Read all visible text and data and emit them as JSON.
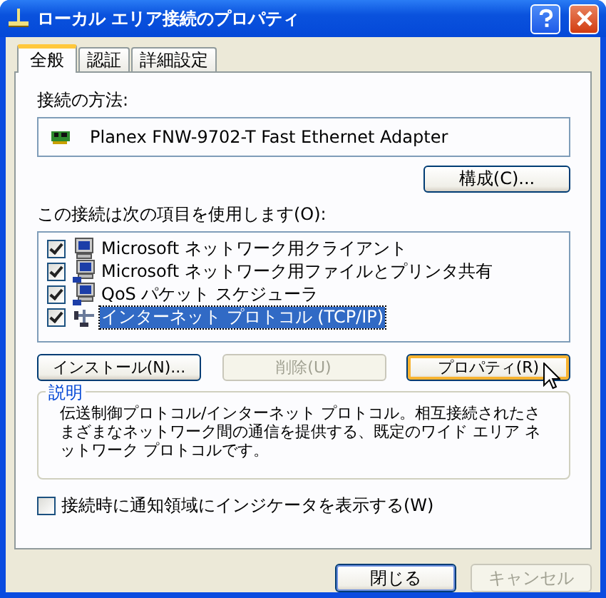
{
  "window": {
    "title": "ローカル エリア接続のプロパティ"
  },
  "tabs": [
    {
      "label": "全般",
      "selected": true
    },
    {
      "label": "認証",
      "selected": false
    },
    {
      "label": "詳細設定",
      "selected": false
    }
  ],
  "connect_using": {
    "label": "接続の方法:",
    "adapter": "Planex FNW-9702-T Fast Ethernet Adapter",
    "configure_button": "構成(C)..."
  },
  "components": {
    "label": "この接続は次の項目を使用します(O):",
    "items": [
      {
        "name": "Microsoft ネットワーク用クライアント",
        "checked": true,
        "selected": false,
        "kind": "client"
      },
      {
        "name": "Microsoft ネットワーク用ファイルとプリンタ共有",
        "checked": true,
        "selected": false,
        "kind": "service"
      },
      {
        "name": "QoS パケット スケジューラ",
        "checked": true,
        "selected": false,
        "kind": "service"
      },
      {
        "name": "インターネット プロトコル (TCP/IP)",
        "checked": true,
        "selected": true,
        "kind": "protocol"
      }
    ]
  },
  "item_buttons": [
    {
      "label": "インストール(N)...",
      "disabled": false,
      "hovered": false
    },
    {
      "label": "削除(U)",
      "disabled": true,
      "hovered": false
    },
    {
      "label": "プロパティ(R)",
      "disabled": false,
      "hovered": true
    }
  ],
  "description": {
    "title": "説明",
    "text": "伝送制御プロトコル/インターネット プロトコル。相互接続されたさまざまなネットワーク間の通信を提供する、既定のワイド エリア ネットワーク プロトコルです。"
  },
  "notify_checkbox": {
    "label": "接続時に通知領域にインジケータを表示する(W)",
    "checked": false
  },
  "footer_buttons": [
    {
      "label": "閉じる",
      "disabled": false,
      "default": true
    },
    {
      "label": "キャンセル",
      "disabled": true,
      "default": false
    }
  ]
}
